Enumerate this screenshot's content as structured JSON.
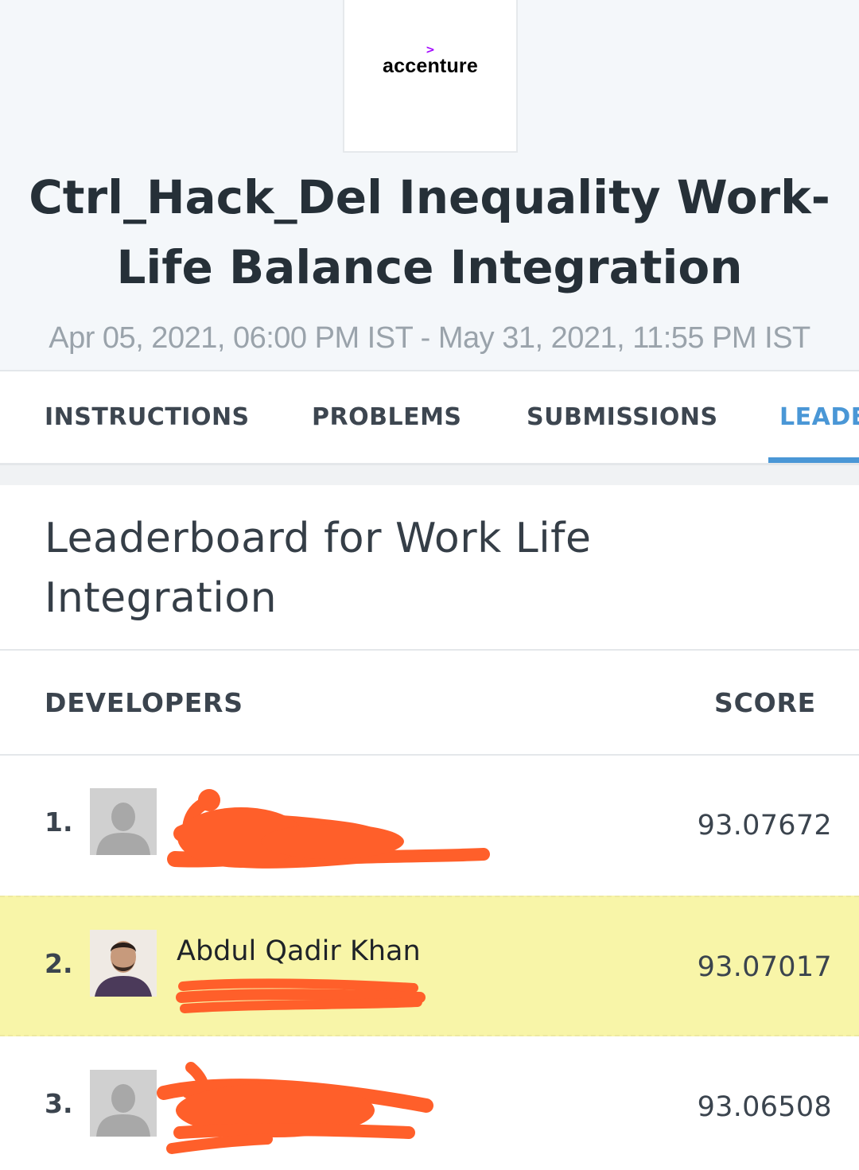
{
  "contest": {
    "logo_text": "accenture",
    "title": "Ctrl_Hack_Del Inequality Work-Life Balance Integration",
    "dates": "Apr 05, 2021, 06:00 PM IST - May 31, 2021, 11:55 PM IST"
  },
  "tabs": [
    {
      "label": "INSTRUCTIONS",
      "active": false
    },
    {
      "label": "PROBLEMS",
      "active": false
    },
    {
      "label": "SUBMISSIONS",
      "active": false
    },
    {
      "label": "LEADE",
      "active": true
    }
  ],
  "leaderboard": {
    "title": "Leaderboard for Work Life Integration",
    "columns": {
      "developers": "DEVELOPERS",
      "score": "SCORE"
    },
    "rows": [
      {
        "rank": "1.",
        "name": "",
        "score": "93.07672",
        "avatar": "default-user-avatar",
        "redacted": true,
        "highlighted": false
      },
      {
        "rank": "2.",
        "name": "Abdul Qadir Khan",
        "score": "93.07017",
        "avatar": "user-photo-avatar",
        "redacted": true,
        "highlighted": true
      },
      {
        "rank": "3.",
        "name": "",
        "score": "93.06508",
        "avatar": "default-user-avatar",
        "redacted": true,
        "highlighted": false
      }
    ]
  },
  "colors": {
    "accent": "#4a97d6",
    "logo_accent": "#a100ff",
    "highlight_row": "#f8f5a8",
    "redaction": "#ff5f2a"
  }
}
